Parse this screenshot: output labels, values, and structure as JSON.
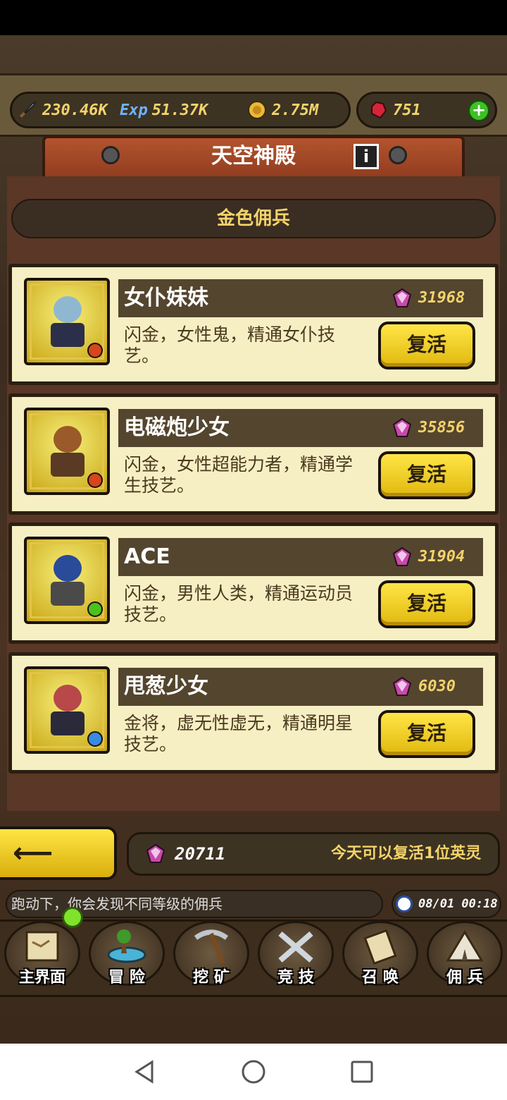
{
  "resources": {
    "attack": "230.46K",
    "exp_label": "Exp",
    "exp": "51.37K",
    "gold": "2.75M",
    "rubies": "751"
  },
  "header": {
    "title": "天空神殿",
    "info_label": "i"
  },
  "section": {
    "title": "金色佣兵"
  },
  "cards": [
    {
      "name": "女仆妹妹",
      "price": "31968",
      "desc": "闪金，女性鬼，精通女仆技艺。",
      "button": "复活",
      "badge_color": "#d6451b",
      "hair": "#8fb8d0",
      "outfit": "#2b2f4a"
    },
    {
      "name": "电磁炮少女",
      "price": "35856",
      "desc": "闪金，女性超能力者，精通学生技艺。",
      "button": "复活",
      "badge_color": "#d6451b",
      "hair": "#9a5a2a",
      "outfit": "#5a3a24"
    },
    {
      "name": "ACE",
      "price": "31904",
      "desc": "闪金，男性人类，精通运动员技艺。",
      "button": "复活",
      "badge_color": "#4cc11e",
      "hair": "#2a4a9a",
      "outfit": "#4a4a4a"
    },
    {
      "name": "甩葱少女",
      "price": "6030",
      "desc": "金将，虚无性虚无，精通明星技艺。",
      "button": "复活",
      "badge_color": "#3a8ae0",
      "hair": "#b8484a",
      "outfit": "#2a2a3a"
    }
  ],
  "footer": {
    "gems": "20711",
    "note": "今天可以复活1位英灵"
  },
  "ticker": "跑动下，你会发现不同等级的佣兵",
  "clock": "08/01 00:18",
  "nav": [
    {
      "label": "主界面",
      "icon": "scroll-map-icon"
    },
    {
      "label": "冒 险",
      "icon": "island-icon"
    },
    {
      "label": "挖 矿",
      "icon": "pickaxe-icon"
    },
    {
      "label": "竞 技",
      "icon": "crossed-swords-icon"
    },
    {
      "label": "召 唤",
      "icon": "summon-scroll-icon"
    },
    {
      "label": "佣 兵",
      "icon": "tent-icon"
    }
  ]
}
